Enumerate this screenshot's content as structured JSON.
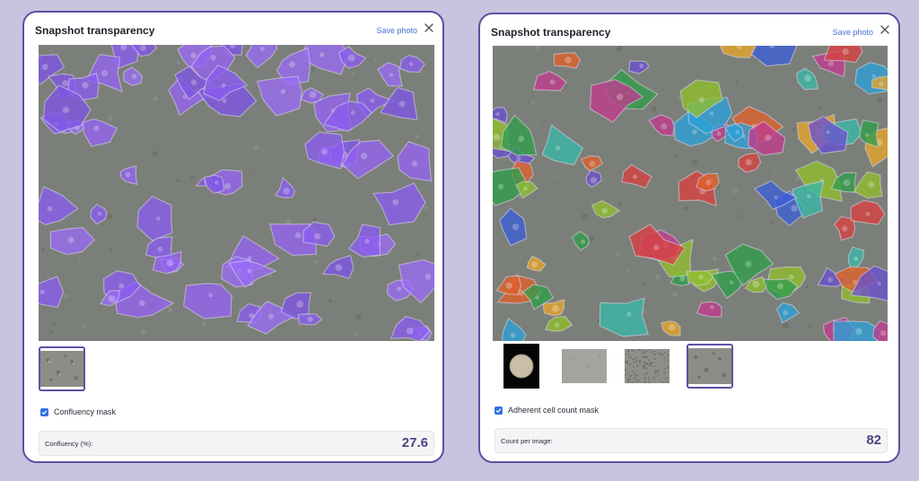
{
  "colors": {
    "background": "#c8c4df",
    "panel_border": "#5d4fa3",
    "link": "#4a6fd6",
    "checkbox": "#2f6fe0",
    "value_text": "#4b4483",
    "mask_purple": "#8a5cf0"
  },
  "left_panel": {
    "title": "Snapshot transparency",
    "save_label": "Save photo",
    "close_icon": "close-icon",
    "image": "phase-contrast micrograph of adherent cells with purple confluency overlay",
    "thumbnails": [
      {
        "type": "cells",
        "selected": true
      }
    ],
    "checkbox_label": "Confluency mask",
    "checkbox_checked": true,
    "stat_label": "Confluency (%):",
    "stat_value": "27.6"
  },
  "right_panel": {
    "title": "Snapshot transparency",
    "save_label": "Save photo",
    "close_icon": "close-icon",
    "image": "phase-contrast micrograph of adherent cells with multicolor per-cell segmentation overlay",
    "thumbnails": [
      {
        "type": "well-overview",
        "selected": false
      },
      {
        "type": "plain-field",
        "selected": false
      },
      {
        "type": "dense-field",
        "selected": false
      },
      {
        "type": "cells",
        "selected": true
      }
    ],
    "checkbox_label": "Adherent cell count mask",
    "checkbox_checked": true,
    "stat_label": "Count per image:",
    "stat_value": "82"
  }
}
